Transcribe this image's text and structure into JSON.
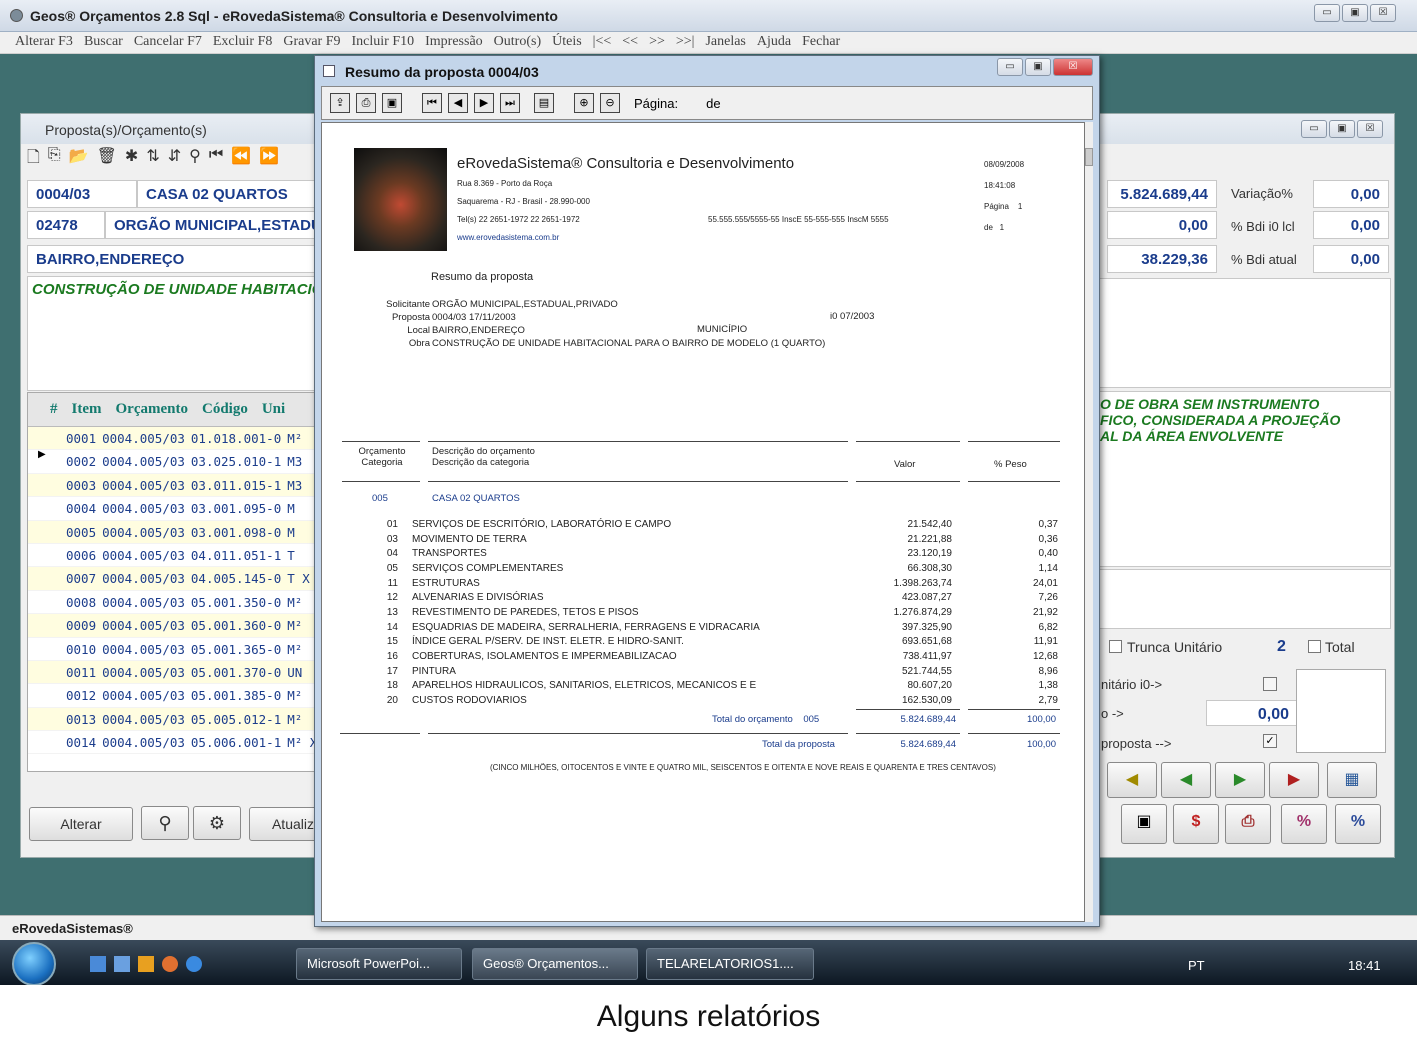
{
  "window": {
    "title": "Geos® Orçamentos 2.8 Sql - eRovedaSistema® Consultoria e Desenvolvimento",
    "controls": [
      "▭",
      "▣",
      "☒"
    ]
  },
  "menu": [
    "Alterar F3",
    "Buscar",
    "Cancelar F7",
    "Excluir F8",
    "Gravar F9",
    "Incluir F10",
    "Impressão",
    "Outro(s)",
    "Úteis",
    "|<<",
    "<<",
    ">>",
    ">>|",
    "Janelas",
    "Ajuda",
    "Fechar"
  ],
  "child": {
    "title": "Proposta(s)/Orçamento(s)",
    "code1": "0004/03",
    "name1": "CASA 02 QUARTOS",
    "code2": "02478",
    "name2": "ORGÃO MUNICIPAL,ESTADUA",
    "address": "BAIRRO,ENDEREÇO",
    "obra": "CONSTRUÇÃO DE UNIDADE HABITACIONAL",
    "right_note": [
      "O DE OBRA SEM INSTRUMENTO",
      "FICO, CONSIDERADA A PROJEÇÃO",
      "AL DA ÁREA ENVOLVENTE"
    ],
    "totals": {
      "total": "5.824.689,44",
      "variacao_label": "Variação%",
      "variacao": "0,00",
      "v2": "0,00",
      "bdi_i0_label": "% Bdi i0 lcl",
      "bdi_i0": "0,00",
      "v3": "38.229,36",
      "bdi_atual_label": "% Bdi atual",
      "bdi_atual": "0,00"
    },
    "options": {
      "trunca": "Trunca Unitário",
      "trunca_value": "2",
      "total": "Total",
      "unitario": "nitário i0->",
      "o_label": "o ->",
      "o_value": "0,00",
      "proposta": "proposta -->"
    },
    "grid_headers": [
      "#",
      "Item",
      "Orçamento",
      "Código",
      "Uni"
    ],
    "rows": [
      {
        "item": "0001",
        "orc": "0004.005/03",
        "cod": "01.018.001-0",
        "un": "M²"
      },
      {
        "item": "0002",
        "orc": "0004.005/03",
        "cod": "03.025.010-1",
        "un": "M3"
      },
      {
        "item": "0003",
        "orc": "0004.005/03",
        "cod": "03.011.015-1",
        "un": "M3"
      },
      {
        "item": "0004",
        "orc": "0004.005/03",
        "cod": "03.001.095-0",
        "un": "M"
      },
      {
        "item": "0005",
        "orc": "0004.005/03",
        "cod": "03.001.098-0",
        "un": "M"
      },
      {
        "item": "0006",
        "orc": "0004.005/03",
        "cod": "04.011.051-1",
        "un": "T"
      },
      {
        "item": "0007",
        "orc": "0004.005/03",
        "cod": "04.005.145-0",
        "un": "T X"
      },
      {
        "item": "0008",
        "orc": "0004.005/03",
        "cod": "05.001.350-0",
        "un": "M²"
      },
      {
        "item": "0009",
        "orc": "0004.005/03",
        "cod": "05.001.360-0",
        "un": "M²"
      },
      {
        "item": "0010",
        "orc": "0004.005/03",
        "cod": "05.001.365-0",
        "un": "M²"
      },
      {
        "item": "0011",
        "orc": "0004.005/03",
        "cod": "05.001.370-0",
        "un": "UN"
      },
      {
        "item": "0012",
        "orc": "0004.005/03",
        "cod": "05.001.385-0",
        "un": "M²"
      },
      {
        "item": "0013",
        "orc": "0004.005/03",
        "cod": "05.005.012-1",
        "un": "M²"
      },
      {
        "item": "0014",
        "orc": "0004.005/03",
        "cod": "05.006.001-1",
        "un": "M² X"
      }
    ],
    "buttons": {
      "alterar": "Alterar",
      "atualiza": "Atualiz"
    }
  },
  "dialog": {
    "title": "Resumo da proposta 0004/03",
    "pagina_label": "Página:",
    "de_label": "de",
    "report": {
      "company": "eRovedaSistema® Consultoria e Desenvolvimento",
      "addr1": "Rua 8.369 - Porto da Roça",
      "addr2": "Saquarema - RJ - Brasil - 28.990-000",
      "phone": "Tel(s) 22 2651-1972 22 2651-1972",
      "ids": "55.555.555/5555-55 InscE 55-555-555 InscM 5555",
      "site": "www.erovedasistema.com.br",
      "date": "08/09/2008",
      "time": "18:41:08",
      "page_label": "Página",
      "page_num": "1",
      "de_label": "de",
      "de_num": "1",
      "heading": "Resumo da proposta",
      "solicitante_label": "Solicitante",
      "solicitante": "ORGÃO MUNICIPAL,ESTADUAL,PRIVADO",
      "proposta_label": "Proposta",
      "proposta": "0004/03  17/11/2003",
      "i0": "i0   07/2003",
      "local_label": "Local",
      "local": "BAIRRO,ENDEREÇO",
      "municipio": "MUNICÍPIO",
      "obra_label": "Obra",
      "obra": "CONSTRUÇÃO DE UNIDADE HABITACIONAL PARA O BAIRRO DE MODELO (1 QUARTO)",
      "col_orc": "Orçamento",
      "col_cat": "Categoria",
      "col_desc1": "Descrição do orçamento",
      "col_desc2": "Descrição da categoria",
      "col_valor": "Valor",
      "col_peso": "% Peso",
      "orc_code": "005",
      "orc_name": "CASA 02 QUARTOS",
      "lines": [
        {
          "n": "01",
          "d": "SERVIÇOS DE ESCRITÓRIO, LABORATÓRIO E CAMPO",
          "v": "21.542,40",
          "p": "0,37"
        },
        {
          "n": "03",
          "d": "MOVIMENTO DE TERRA",
          "v": "21.221,88",
          "p": "0,36"
        },
        {
          "n": "04",
          "d": "TRANSPORTES",
          "v": "23.120,19",
          "p": "0,40"
        },
        {
          "n": "05",
          "d": "SERVIÇOS COMPLEMENTARES",
          "v": "66.308,30",
          "p": "1,14"
        },
        {
          "n": "11",
          "d": "ESTRUTURAS",
          "v": "1.398.263,74",
          "p": "24,01"
        },
        {
          "n": "12",
          "d": "ALVENARIAS E DIVISÓRIAS",
          "v": "423.087,27",
          "p": "7,26"
        },
        {
          "n": "13",
          "d": "REVESTIMENTO DE PAREDES, TETOS E PISOS",
          "v": "1.276.874,29",
          "p": "21,92"
        },
        {
          "n": "14",
          "d": "ESQUADRIAS DE MADEIRA, SERRALHERIA, FERRAGENS E VIDRACARIA",
          "v": "397.325,90",
          "p": "6,82"
        },
        {
          "n": "15",
          "d": "ÍNDICE GERAL P/SERV. DE INST. ELETR. E HIDRO-SANIT.",
          "v": "693.651,68",
          "p": "11,91"
        },
        {
          "n": "16",
          "d": "COBERTURAS, ISOLAMENTOS E IMPERMEABILIZACAO",
          "v": "738.411,97",
          "p": "12,68"
        },
        {
          "n": "17",
          "d": "PINTURA",
          "v": "521.744,55",
          "p": "8,96"
        },
        {
          "n": "18",
          "d": "APARELHOS HIDRAULICOS, SANITARIOS, ELETRICOS, MECANICOS E E",
          "v": "80.607,20",
          "p": "1,38"
        },
        {
          "n": "20",
          "d": "CUSTOS RODOVIARIOS",
          "v": "162.530,09",
          "p": "2,79"
        }
      ],
      "total_orc_label": "Total do orçamento",
      "total_orc_code": "005",
      "total_orc_v": "5.824.689,44",
      "total_orc_p": "100,00",
      "total_prop_label": "Total da proposta",
      "total_prop_v": "5.824.689,44",
      "total_prop_p": "100,00",
      "extenso": "(CINCO MILHÕES, OITOCENTOS E VINTE E QUATRO MIL, SEISCENTOS E OITENTA E NOVE REAIS E QUARENTA E TRES CENTAVOS)"
    }
  },
  "status": "eRovedaSistemas®",
  "taskbar": {
    "tasks": [
      "Microsoft PowerPoi...",
      "Geos® Orçamentos...",
      "TELARELATORIOS1...."
    ],
    "lang": "PT",
    "clock": "18:41"
  },
  "caption": "Alguns relatórios",
  "colors": {
    "teal": "#3f6f70",
    "blue_text": "#1a3c8c",
    "green_text": "#1b7a20"
  }
}
